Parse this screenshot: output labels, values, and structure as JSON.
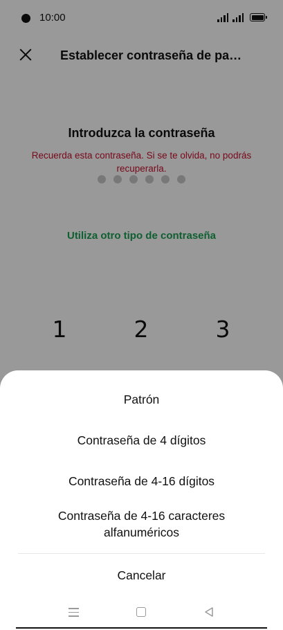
{
  "status_bar": {
    "time": "10:00"
  },
  "header": {
    "title": "Establecer contraseña de pant…"
  },
  "main": {
    "prompt": "Introduzca la contraseña",
    "warning": "Recuerda esta contraseña. Si se te olvida, no podrás recuperarla.",
    "pin_length": 6,
    "other_type_link": "Utiliza otro tipo de contraseña",
    "keypad": [
      "1",
      "2",
      "3"
    ]
  },
  "sheet": {
    "options": [
      "Patrón",
      "Contraseña de 4 dígitos",
      "Contraseña de 4-16 dígitos",
      "Contraseña de 4-16 caracteres alfanuméricos"
    ],
    "cancel_label": "Cancelar"
  },
  "colors": {
    "warning": "#c8102e",
    "link": "#1a9e52",
    "overlay": "rgba(0,0,0,0.4)"
  },
  "icons": {
    "close": "close-icon",
    "nav_menu": "menu-icon",
    "nav_home": "home-icon",
    "nav_back": "back-icon"
  }
}
